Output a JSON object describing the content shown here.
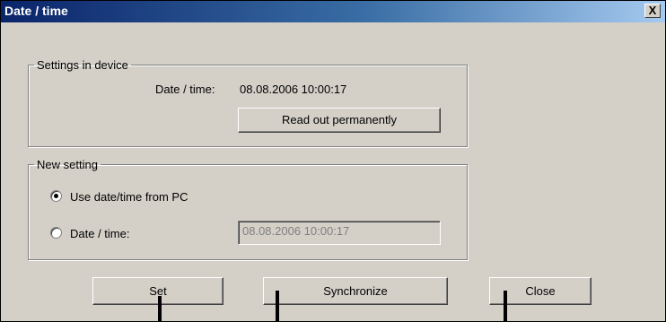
{
  "window": {
    "title": "Date / time",
    "close_glyph": "X"
  },
  "settings_in_device": {
    "legend": "Settings in device",
    "datetime_label": "Date / time:",
    "datetime_value": "08.08.2006 10:00:17",
    "read_out_button": "Read out permanently"
  },
  "new_setting": {
    "legend": "New setting",
    "option_pc": {
      "label": "Use date/time from PC",
      "selected": true
    },
    "option_manual": {
      "label": "Date / time:",
      "selected": false
    },
    "datetime_input": "08.08.2006 10:00:17"
  },
  "buttons": {
    "set": "Set",
    "synchronize": "Synchronize",
    "close": "Close"
  },
  "colors": {
    "dialog_bg": "#d4d0c8",
    "title_start": "#0a246a",
    "title_end": "#a6caf0"
  }
}
